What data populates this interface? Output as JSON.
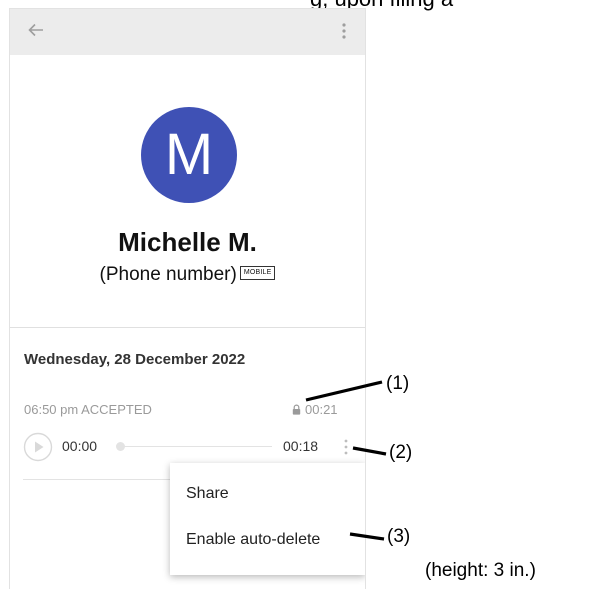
{
  "page_fragment": "g, upon filing a",
  "appbar": {
    "back_icon": "arrow-left-icon",
    "more_icon": "more-vert-icon"
  },
  "contact": {
    "avatar_letter": "M",
    "avatar_color": "#3f51b5",
    "name": "Michelle M.",
    "phone": "(Phone number)",
    "type_badge": "MOBILE"
  },
  "history": {
    "date": "Wednesday, 28 December 2022",
    "call_time_status": "06:50 pm  ACCEPTED",
    "lock_icon": "lock-icon",
    "call_duration": "00:21",
    "player": {
      "play_icon": "play-icon",
      "position": "00:00",
      "length": "00:18",
      "more_icon": "more-vert-icon"
    }
  },
  "menu": {
    "items": [
      "Share",
      "Enable auto-delete"
    ]
  },
  "annotations": {
    "labels": [
      "(1)",
      "(2)",
      "(3)"
    ],
    "height_note": "(height: 3 in.)"
  }
}
